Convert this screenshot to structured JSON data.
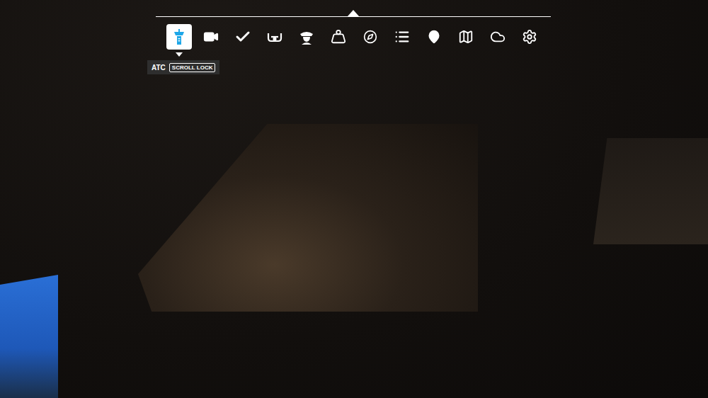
{
  "toolbar": {
    "items": [
      {
        "kind": "atc",
        "selected": true
      },
      {
        "kind": "camera",
        "selected": false
      },
      {
        "kind": "checklist",
        "selected": false
      },
      {
        "kind": "controls",
        "selected": false
      },
      {
        "kind": "pilot",
        "selected": false
      },
      {
        "kind": "weight",
        "selected": false
      },
      {
        "kind": "navlog",
        "selected": false
      },
      {
        "kind": "objectives",
        "selected": false
      },
      {
        "kind": "pin",
        "selected": false
      },
      {
        "kind": "map",
        "selected": false
      },
      {
        "kind": "weather",
        "selected": false
      },
      {
        "kind": "settings",
        "selected": false
      }
    ]
  },
  "tooltip": {
    "label": "ATC",
    "key": "SCROLL LOCK"
  }
}
